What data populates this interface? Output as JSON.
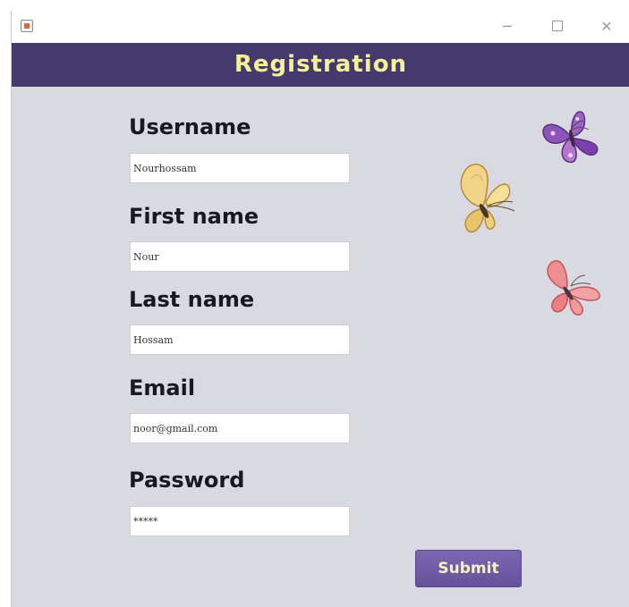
{
  "window": {
    "app_icon": "java-app-icon",
    "controls": {
      "minimize": "─",
      "close": "✕"
    }
  },
  "header": {
    "title": "Registration"
  },
  "form": {
    "username": {
      "label": "Username",
      "value": "Nourhossam"
    },
    "first_name": {
      "label": "First name",
      "value": "Nour"
    },
    "last_name": {
      "label": "Last name",
      "value": "Hossam"
    },
    "email": {
      "label": "Email",
      "value": "noor@gmail.com"
    },
    "password": {
      "label": "Password",
      "value": "*****"
    },
    "submit_label": "Submit"
  },
  "colors": {
    "header_bg": "#453a6e",
    "header_text": "#f6f199",
    "content_bg": "#d8d9e1",
    "button_bg": "#6f5ea7",
    "button_text": "#fbf3b4"
  },
  "decorations": [
    "purple-butterfly",
    "yellow-butterfly",
    "pink-butterfly"
  ]
}
